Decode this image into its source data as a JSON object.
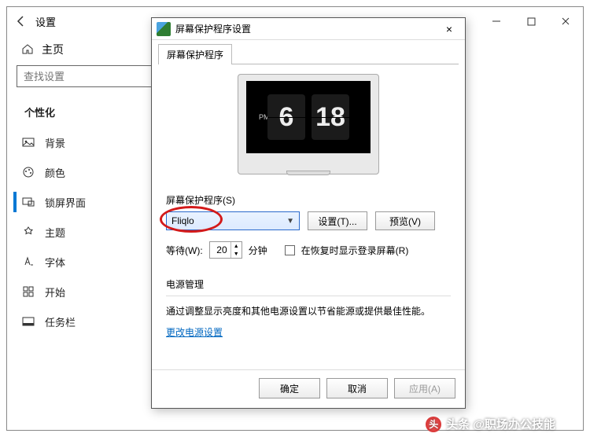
{
  "settings": {
    "title": "设置",
    "home": "主页",
    "search_placeholder": "查找设置",
    "section": "个性化",
    "items": [
      {
        "label": "背景"
      },
      {
        "label": "颜色"
      },
      {
        "label": "锁屏界面"
      },
      {
        "label": "主题"
      },
      {
        "label": "字体"
      },
      {
        "label": "开始"
      },
      {
        "label": "任务栏"
      }
    ]
  },
  "dialog": {
    "title": "屏幕保护程序设置",
    "close": "×",
    "tab": "屏幕保护程序",
    "preview": {
      "time_h": "6",
      "time_m": "18",
      "meridiem": "PM"
    },
    "saver_group": "屏幕保护程序(S)",
    "combo_value": "Fliqlo",
    "settings_btn": "设置(T)...",
    "preview_btn": "预览(V)",
    "wait_label": "等待(W):",
    "wait_value": "20",
    "wait_unit": "分钟",
    "resume_chk": "在恢复时显示登录屏幕(R)",
    "power_title": "电源管理",
    "power_text": "通过调整显示亮度和其他电源设置以节省能源或提供最佳性能。",
    "power_link": "更改电源设置",
    "ok": "确定",
    "cancel": "取消",
    "apply": "应用(A)"
  },
  "watermark": {
    "author": "头条 @职场办公技能",
    "icon": "头"
  }
}
